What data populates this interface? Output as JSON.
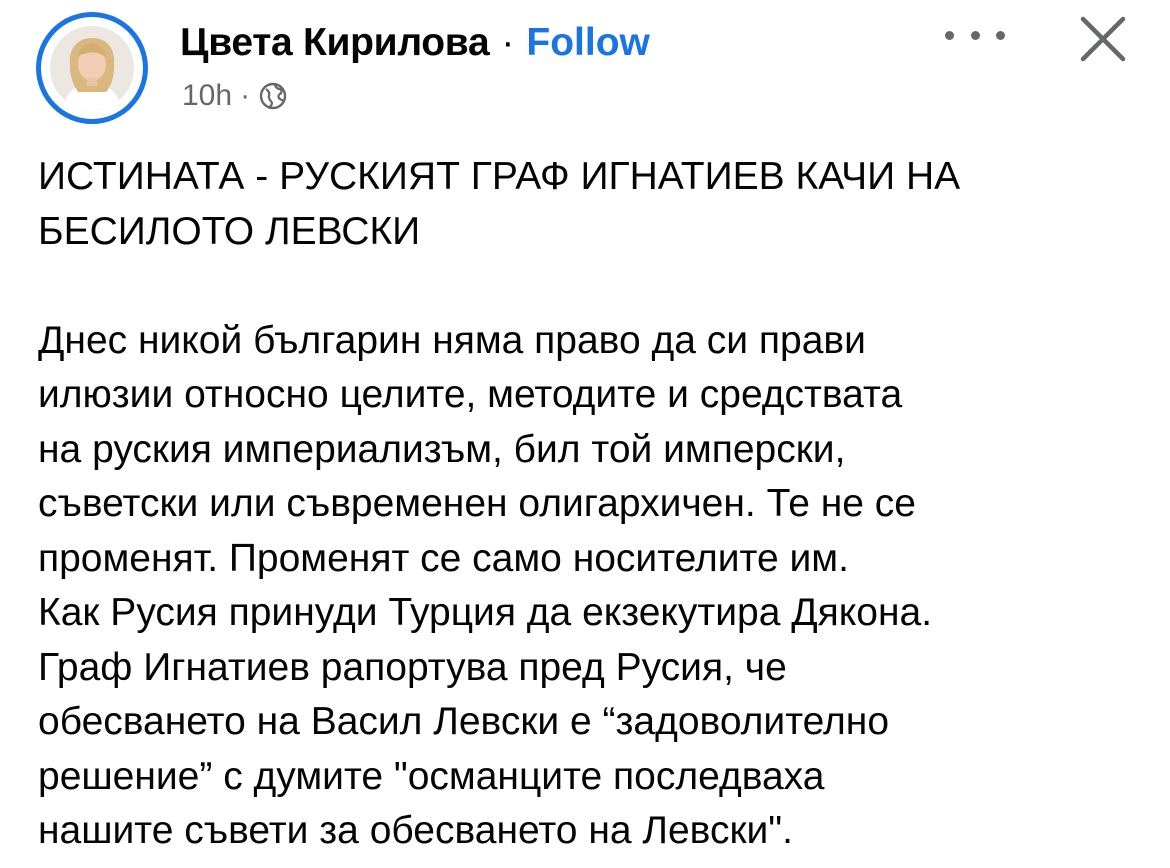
{
  "post": {
    "author_name": "Цвета Кирилова",
    "separator": "·",
    "follow_label": "Follow",
    "timestamp": "10h",
    "meta_separator": "·",
    "audience_icon": "globe-icon",
    "more_icon": "more-options-icon",
    "close_icon": "close-icon",
    "title": "ИСТИНАТА - РУСКИЯТ ГРАФ ИГНАТИЕВ КАЧИ НА\nБЕСИЛОТО ЛЕВСКИ",
    "body": "Днес никой българин няма право да си прави\nилюзии относно целите, методите и средствата\nна руския империализъм, бил той имперски,\nсъветски или съвременен олигархичен. Те не се\nпроменят. Променят се само носителите им.\nКак Русия принуди Турция да екзекутира Дякона.\nГраф Игнатиев рапортува пред Русия, че\nобесването на Васил Левски е “задоволително\nрешение” с думите \"османците последваха\nнашите съвети за обесването на Левски\"."
  },
  "colors": {
    "accent": "#1b74e4",
    "text": "#050505",
    "secondary_text": "#65676b"
  }
}
